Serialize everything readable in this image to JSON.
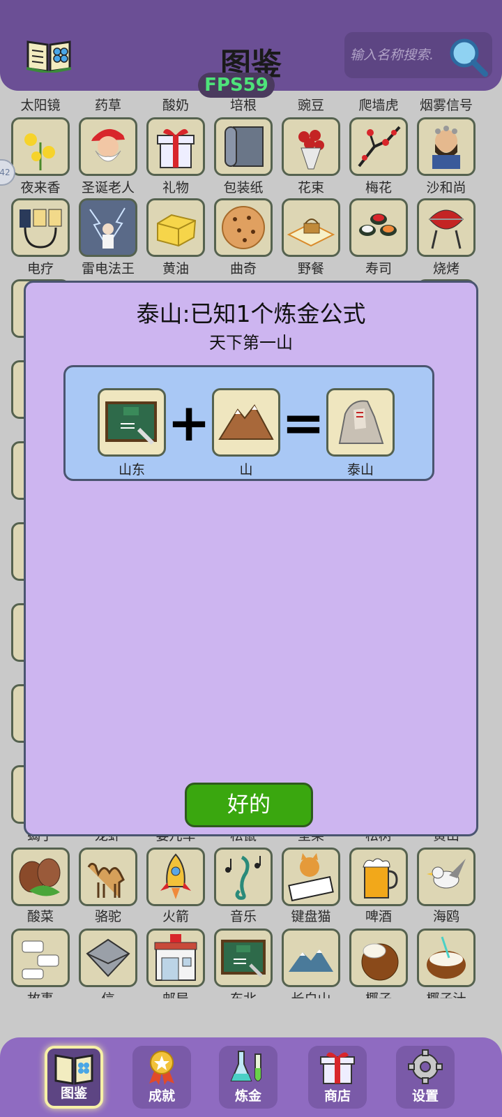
{
  "header": {
    "title": "图鉴",
    "search_placeholder": "输入名称搜索.",
    "fps": "FPS59",
    "book_icon": "book-icon",
    "search_icon": "magnifier-icon"
  },
  "side_tab": "42",
  "grid_labels_row0": [
    "太阳镜",
    "药草",
    "酸奶",
    "培根",
    "豌豆",
    "爬墙虎",
    "烟雾信号"
  ],
  "grid_row1": [
    "夜来香",
    "圣诞老人",
    "礼物",
    "包装纸",
    "花束",
    "梅花",
    "沙和尚"
  ],
  "grid_row2": [
    "电疗",
    "雷电法王",
    "黄油",
    "曲奇",
    "野餐",
    "寿司",
    "烧烤"
  ],
  "grid_row3": [
    "蝎子",
    "龙虾",
    "婴儿车",
    "松鼠",
    "坚果",
    "松树",
    "黄山"
  ],
  "grid_row4": [
    "酸菜",
    "骆驼",
    "火箭",
    "音乐",
    "键盘猫",
    "啤酒",
    "海鸥"
  ],
  "grid_row5": [
    "故事",
    "信",
    "邮局",
    "东北",
    "长白山",
    "椰子",
    "椰子汁"
  ],
  "dialog": {
    "title": "泰山:已知1个炼金公式",
    "subtitle": "天下第一山",
    "formula": {
      "a": "山东",
      "b": "山",
      "result": "泰山",
      "plus": "+",
      "equals": "="
    },
    "ok_label": "好的"
  },
  "nav": [
    {
      "label": "图鉴",
      "icon": "book-icon",
      "active": true
    },
    {
      "label": "成就",
      "icon": "medal-icon",
      "active": false
    },
    {
      "label": "炼金",
      "icon": "flask-icon",
      "active": false
    },
    {
      "label": "商店",
      "icon": "gift-icon",
      "active": false
    },
    {
      "label": "设置",
      "icon": "gear-icon",
      "active": false
    }
  ]
}
